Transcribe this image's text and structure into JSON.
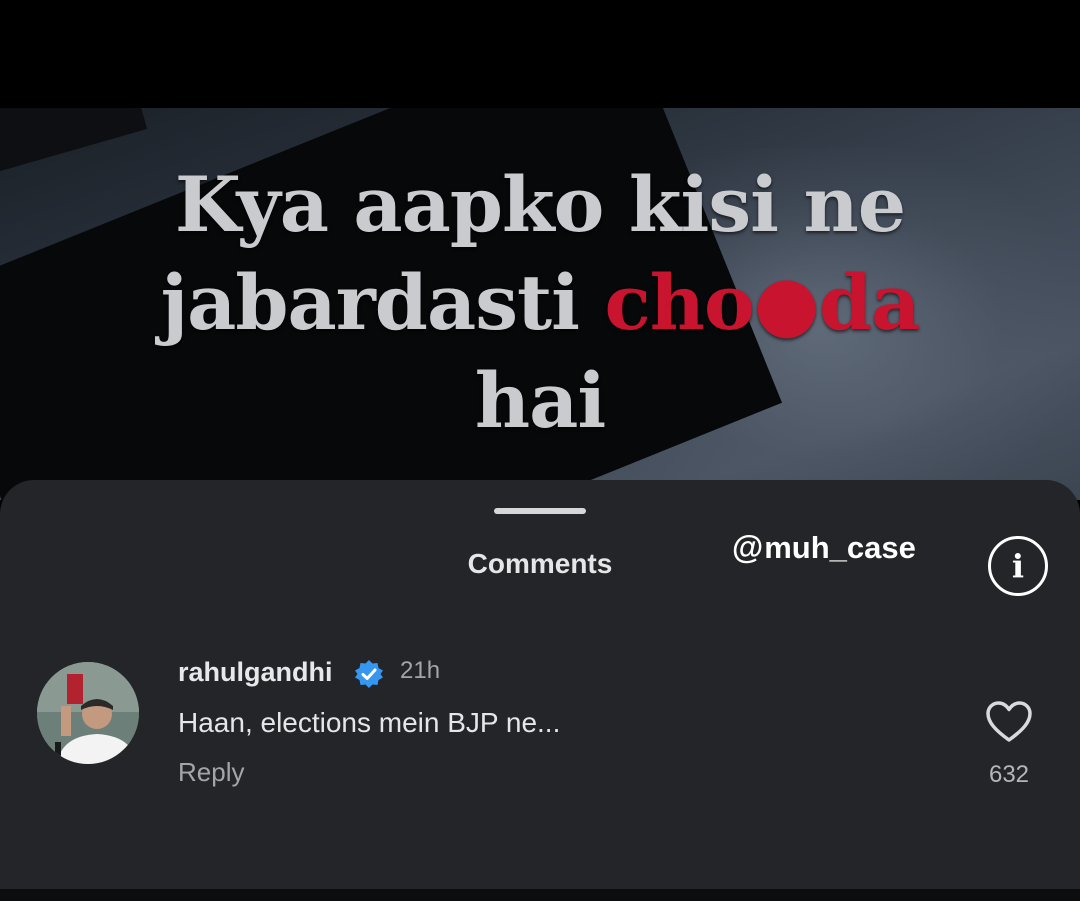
{
  "video": {
    "caption_line1": "Kya aapko kisi ne",
    "caption_line2_white": "jabardasti",
    "caption_line2_red": "cho●da",
    "caption_line3": "hai"
  },
  "comments_sheet": {
    "title": "Comments",
    "watermark": "muh_case",
    "info_icon": "info-icon"
  },
  "comment": {
    "username": "rahulgandhi",
    "verified": true,
    "time": "21h",
    "text": "Haan, elections mein BJP ne...",
    "reply_label": "Reply",
    "like_count": "632"
  },
  "colors": {
    "sheet_bg": "#242528",
    "caption_red": "#c8142e",
    "verified_blue": "#3797f0"
  }
}
